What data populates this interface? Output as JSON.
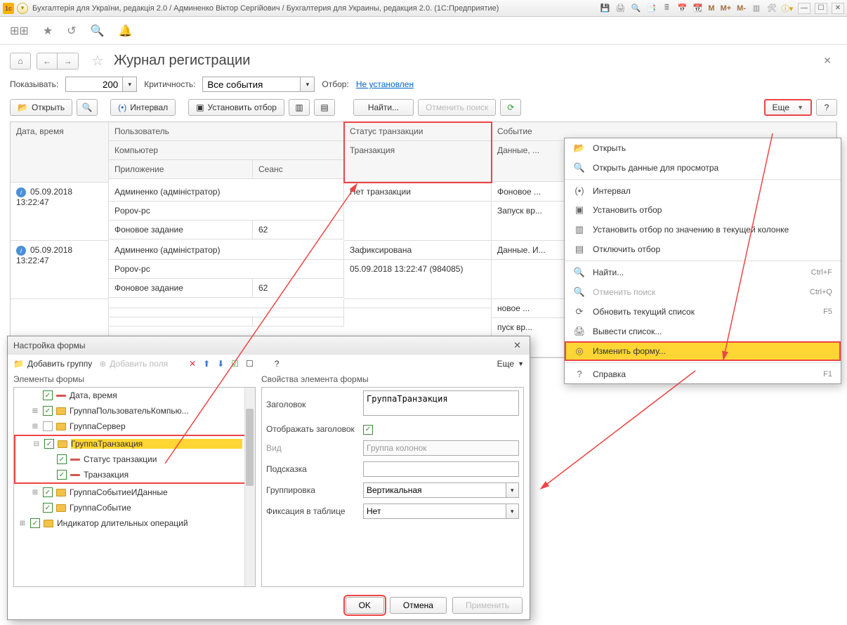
{
  "titlebar": {
    "logo": "1c",
    "title": "Бухгалтерія для України, редакція 2.0 / Админенко Віктор Сергійович / Бухгалтерия для Украины, редакция 2.0. (1С:Предприятие)",
    "m1": "M",
    "m2": "M+",
    "m3": "M-"
  },
  "page": {
    "title": "Журнал регистрации"
  },
  "filter": {
    "showLabel": "Показывать:",
    "showValue": "200",
    "critLabel": "Критичность:",
    "critValue": "Все события",
    "selLabel": "Отбор:",
    "selLink": "Не установлен"
  },
  "toolbar": {
    "open": "Открыть",
    "interval": "Интервал",
    "setFilter": "Установить отбор",
    "find": "Найти...",
    "cancelFind": "Отменить поиск",
    "more": "Еще",
    "help": "?"
  },
  "grid": {
    "headers": {
      "dt": "Дата, время",
      "user": "Пользователь",
      "comp": "Компьютер",
      "app": "Приложение",
      "sess": "Сеанс",
      "txStatus": "Статус транзакции",
      "tx": "Транзакция",
      "evt": "Событие",
      "data": "Данные, ..."
    },
    "rows": [
      {
        "dt": "05.09.2018 13:22:47",
        "user": "Админенко (адміністратор)",
        "comp": "Popov-pc",
        "app": "Фоновое задание",
        "sess": "62",
        "txStatus": "Нет транзакции",
        "tx": "",
        "evt": "Фоновое ...",
        "data": "Запуск вр..."
      },
      {
        "dt": "05.09.2018 13:22:47",
        "user": "Админенко (адміністратор)",
        "comp": "Popov-pc",
        "app": "Фоновое задание",
        "sess": "62",
        "txStatus": "Зафиксирована",
        "tx": "05.09.2018 13:22:47 (984085)",
        "evt": "Данные. И...",
        "data": ""
      },
      {
        "dt": "",
        "user": "",
        "comp": "",
        "app": "",
        "sess": "",
        "txStatus": "",
        "tx": "",
        "evt": "новое ...",
        "data": "пуск вр..."
      }
    ]
  },
  "menu": {
    "items": [
      {
        "icon": "📂",
        "label": "Открыть"
      },
      {
        "icon": "🔍",
        "label": "Открыть данные для просмотра"
      },
      {
        "sep": true
      },
      {
        "icon": "(•)",
        "label": "Интервал"
      },
      {
        "icon": "▣",
        "label": "Установить отбор"
      },
      {
        "icon": "▥",
        "label": "Установить отбор по значению в текущей колонке"
      },
      {
        "icon": "▤",
        "label": "Отключить отбор"
      },
      {
        "sep": true
      },
      {
        "icon": "🔍",
        "label": "Найти...",
        "sc": "Ctrl+F"
      },
      {
        "icon": "🔍",
        "label": "Отменить поиск",
        "sc": "Ctrl+Q",
        "dis": true
      },
      {
        "icon": "⟳",
        "label": "Обновить текущий список",
        "sc": "F5"
      },
      {
        "icon": "🖨",
        "label": "Вывести список..."
      },
      {
        "icon": "◎",
        "label": "Изменить форму...",
        "hl": true
      },
      {
        "sep": true
      },
      {
        "icon": "?",
        "label": "Справка",
        "sc": "F1"
      }
    ]
  },
  "modal": {
    "title": "Настройка формы",
    "addGroup": "Добавить группу",
    "addFields": "Добавить поля",
    "more": "Еще",
    "help": "?",
    "leftHdr": "Элементы формы",
    "rightHdr": "Свойства элемента формы",
    "tree": [
      {
        "ind": 1,
        "exp": "",
        "chk": true,
        "folder": false,
        "label": "Дата, время"
      },
      {
        "ind": 1,
        "exp": "⊞",
        "chk": true,
        "folder": true,
        "label": "ГруппаПользовательКомпью..."
      },
      {
        "ind": 1,
        "exp": "⊞",
        "chk": false,
        "folder": true,
        "label": "ГруппаСервер"
      },
      {
        "ind": 1,
        "exp": "⊟",
        "chk": true,
        "folder": true,
        "label": "ГруппаТранзакция",
        "sel": true,
        "redstart": true
      },
      {
        "ind": 2,
        "exp": "",
        "chk": true,
        "folder": false,
        "label": "Статус транзакции"
      },
      {
        "ind": 2,
        "exp": "",
        "chk": true,
        "folder": false,
        "label": "Транзакция",
        "redend": true
      },
      {
        "ind": 1,
        "exp": "⊞",
        "chk": true,
        "folder": true,
        "label": "ГруппаСобытиеИДанные"
      },
      {
        "ind": 1,
        "exp": "",
        "chk": true,
        "folder": true,
        "label": "ГруппаСобытие"
      },
      {
        "ind": 0,
        "exp": "⊞",
        "chk": true,
        "folder": true,
        "label": "Индикатор длительных операций"
      }
    ],
    "props": {
      "titleLbl": "Заголовок",
      "titleVal": "ГруппаТранзакция",
      "showTitleLbl": "Отображать заголовок",
      "showTitleChk": true,
      "kindLbl": "Вид",
      "kindVal": "Группа колонок",
      "hintLbl": "Подсказка",
      "hintVal": "",
      "groupLbl": "Группировка",
      "groupVal": "Вертикальная",
      "fixLbl": "Фиксация в таблице",
      "fixVal": "Нет"
    },
    "ok": "OK",
    "cancel": "Отмена",
    "apply": "Применить"
  }
}
